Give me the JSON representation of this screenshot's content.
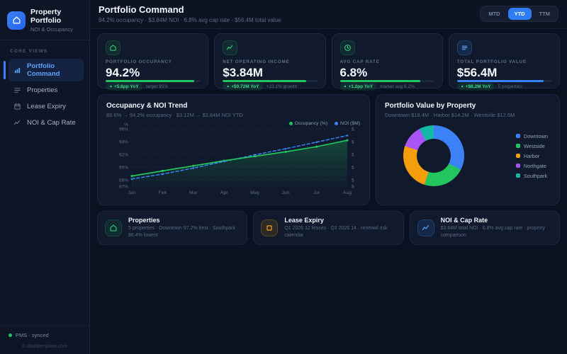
{
  "sidebar": {
    "logo_title": "Property Portfolio",
    "logo_subtitle": "NOI & Occupancy",
    "section_label": "CORE VIEWS",
    "items": [
      {
        "label": "Portfolio Command",
        "icon": "bar-chart",
        "active": true
      },
      {
        "label": "Properties",
        "icon": "rows",
        "active": false
      },
      {
        "label": "Lease Expiry",
        "icon": "calendar",
        "active": false
      },
      {
        "label": "NOI & Cap Rate",
        "icon": "trend",
        "active": false
      }
    ],
    "footer_status": "PMS · synced",
    "footer_copyright": "© dashtemplate.com"
  },
  "header": {
    "title": "Portfolio Command",
    "subtitle": "94.2% occupancy · $3.84M NOI · 6.8% avg cap rate · $56.4M total value",
    "range_buttons": [
      "MTD",
      "YTD",
      "TTM"
    ],
    "active_range": "YTD"
  },
  "kpis": [
    {
      "label": "PORTFOLIO OCCUPANCY",
      "value": "94.2%",
      "badge": "+5.6pp YoY",
      "note": "target 95%",
      "progress": 94,
      "accent": "#22c55e",
      "tile": "green",
      "icon": "home"
    },
    {
      "label": "NET OPERATING INCOME",
      "value": "$3.84M",
      "badge": "+$0.72M YoY",
      "note": "+23.1% growth",
      "progress": 88,
      "accent": "#22c55e",
      "tile": "green",
      "icon": "trend"
    },
    {
      "label": "AVG CAP RATE",
      "value": "6.8%",
      "badge": "+1.2pp YoY",
      "note": "market avg 6.2%",
      "progress": 85,
      "accent": "#22c55e",
      "tile": "green",
      "icon": "clock"
    },
    {
      "label": "TOTAL PORTFOLIO VALUE",
      "value": "$56.4M",
      "badge": "+$8.2M YoY",
      "note": "5 properties",
      "progress": 92,
      "accent": "#3b82f6",
      "tile": "blue",
      "icon": "menu"
    }
  ],
  "chart_data": [
    {
      "type": "line",
      "title": "Occupancy & NOI Trend",
      "subtitle": "88.6% → 94.2% occupancy · $3.12M → $3.84M NOI YTD",
      "categories": [
        "Jan",
        "Feb",
        "Mar",
        "Apr",
        "May",
        "Jun",
        "Jul",
        "Aug"
      ],
      "series": [
        {
          "name": "Occupancy (%)",
          "color": "#22c55e",
          "style": "solid",
          "axis": "left",
          "area": true,
          "values": [
            88.6,
            89.4,
            90.2,
            91.0,
            91.7,
            92.4,
            93.2,
            94.2
          ]
        },
        {
          "name": "NOI ($M)",
          "color": "#3b82f6",
          "style": "dashed",
          "axis": "right",
          "area": false,
          "values": [
            3.12,
            3.2,
            3.3,
            3.41,
            3.52,
            3.62,
            3.73,
            3.84
          ]
        }
      ],
      "left_axis": {
        "unit": "%",
        "range": [
          87,
          96
        ],
        "ticks": [
          96,
          94,
          92,
          90,
          88,
          87
        ],
        "tick_labels": [
          "96%",
          "94%",
          "92%",
          "90%",
          "88%",
          "87%"
        ]
      },
      "right_axis": {
        "unit": "$",
        "range": [
          3.0,
          3.95
        ],
        "tick_labels": [
          "$",
          "$",
          "$",
          "$",
          "$",
          "$"
        ]
      },
      "grid": true,
      "legend_position": "top-right"
    },
    {
      "type": "pie",
      "title": "Portfolio Value by Property",
      "subtitle": "Downtown $18.4M · Harbor $14.2M · Westside $12.6M",
      "unit": "$M",
      "total": 56.4,
      "slices": [
        {
          "label": "Downtown",
          "value": 18.4,
          "color": "#3b82f6"
        },
        {
          "label": "Westside",
          "value": 12.6,
          "color": "#22c55e"
        },
        {
          "label": "Harbor",
          "value": 14.2,
          "color": "#f59e0b"
        },
        {
          "label": "Northgate",
          "value": 6.8,
          "color": "#a855f7"
        },
        {
          "label": "Southpark",
          "value": 4.4,
          "color": "#14b8a6"
        }
      ],
      "legend_position": "right"
    }
  ],
  "bottom_cards": [
    {
      "title": "Properties",
      "subtitle": "5 properties · Downtown 97.2% best · Southpark 86.4% lowest",
      "icon": "home",
      "tile": "green"
    },
    {
      "title": "Lease Expiry",
      "subtitle": "Q1 2026 12 leases · Q3 2026 14 · renewal risk calendar",
      "icon": "square",
      "tile": "amber"
    },
    {
      "title": "NOI & Cap Rate",
      "subtitle": "$3.84M total NOI · 6.8% avg cap rate · property comparison",
      "icon": "trend",
      "tile": "blue"
    }
  ]
}
